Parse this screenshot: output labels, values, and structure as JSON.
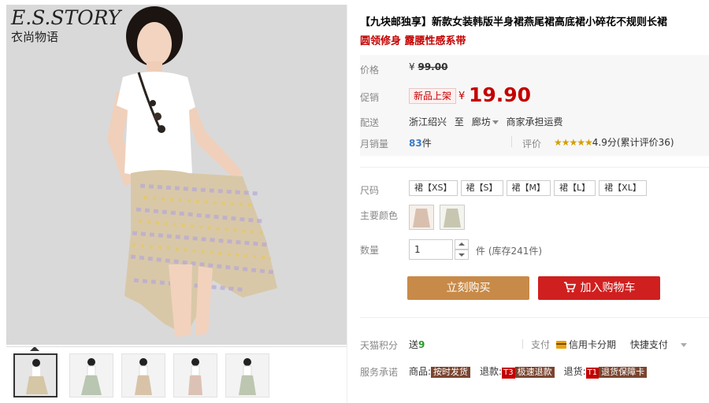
{
  "brand": {
    "name_en": "E.S.STORY",
    "name_cn": "衣尚物语"
  },
  "product": {
    "title": "【九块邮独享】新款女装韩版半身裙燕尾裙高底裙小碎花不规则长裙",
    "subtitle": "圆领修身 露腰性感系带"
  },
  "price": {
    "original_label": "价格",
    "original_currency": "¥",
    "original_value": "99.00",
    "promo_label": "促销",
    "promo_tag": "新品上架",
    "promo_currency": "¥",
    "promo_value": "19.90"
  },
  "shipping": {
    "label": "配送",
    "from": "浙江绍兴",
    "to_word": "至",
    "destination": "廊坊",
    "note": "商家承担运费"
  },
  "sales": {
    "label": "月销量",
    "count": "83",
    "unit": "件",
    "review_label": "评价",
    "stars": "★★★★★",
    "rating_text": "4.9分(累计评价36)"
  },
  "sku": {
    "size_label": "尺码",
    "sizes": [
      "裙【XS】",
      "裙【S】",
      "裙【M】",
      "裙【L】",
      "裙【XL】"
    ],
    "color_label": "主要颜色",
    "quantity_label": "数量",
    "quantity_value": "1",
    "quantity_unit": "件 (库存241件)"
  },
  "actions": {
    "buy_now": "立刻购买",
    "add_to_cart": "加入购物车"
  },
  "extras": {
    "points_label": "天猫积分",
    "points_text": "送",
    "points_value": "9",
    "pay_label": "支付",
    "pay_card": "信用卡分期",
    "pay_fast": "快捷支付",
    "service_label": "服务承诺",
    "svc_goods_prefix": "商品:",
    "svc_goods": "按时发货",
    "svc_refund_prefix": "退款:",
    "svc_refund_tag": "T3",
    "svc_refund": "极速退款",
    "svc_return_prefix": "退货:",
    "svc_return_tag": "T1",
    "svc_return": "退货保障卡"
  },
  "colors": {
    "accent_red": "#c40000",
    "buy_orange": "#c88a48",
    "cart_red": "#d01f1f"
  }
}
